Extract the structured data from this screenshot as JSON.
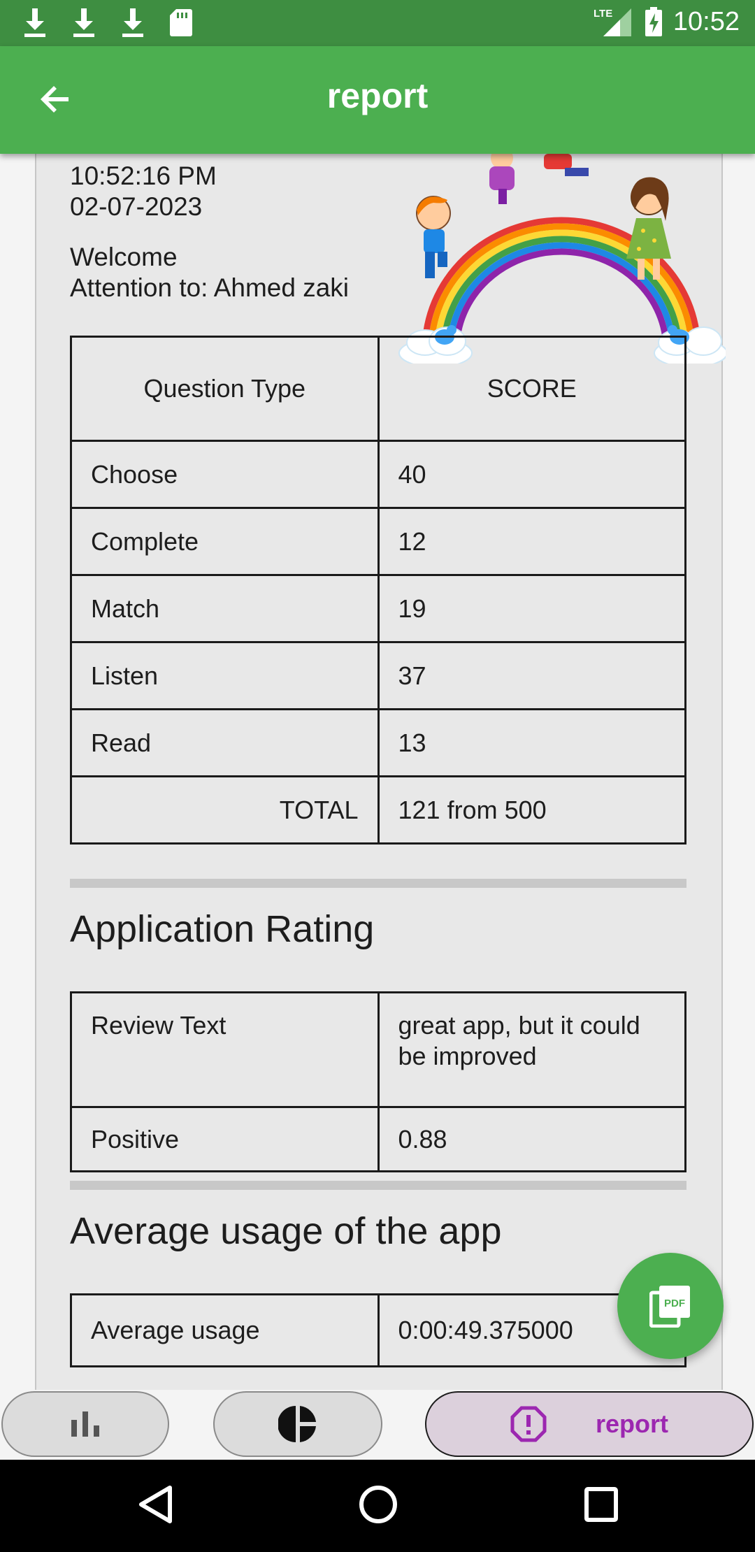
{
  "status_bar": {
    "time": "10:52",
    "network": "LTE",
    "icons": [
      "download-icon",
      "download-icon",
      "download-icon",
      "sd-card-icon",
      "signal-icon",
      "battery-charging-icon"
    ]
  },
  "app_bar": {
    "title": "report",
    "back_icon": "arrow-back-icon"
  },
  "header": {
    "time": "10:52:16 PM",
    "date": "02-07-2023",
    "welcome": "Welcome",
    "attention": "Attention to: Ahmed zaki"
  },
  "scores": {
    "col1": "Question Type",
    "col2": "SCORE",
    "rows": [
      {
        "type": "Choose",
        "score": "40"
      },
      {
        "type": "Complete",
        "score": "12"
      },
      {
        "type": "Match",
        "score": "19"
      },
      {
        "type": "Listen",
        "score": "37"
      },
      {
        "type": "Read",
        "score": "13"
      }
    ],
    "total_label": "TOTAL",
    "total_value": "121 from 500"
  },
  "rating": {
    "title": "Application Rating",
    "review_label": "Review Text",
    "review_value": "great app, but it could be improved",
    "sentiment_label": "Positive",
    "sentiment_value": "0.88"
  },
  "usage": {
    "title": "Average usage of the app",
    "label": "Average usage",
    "value": "0:00:49.375000"
  },
  "fab": {
    "icon": "pdf-icon"
  },
  "bottom_tabs": [
    {
      "icon": "bar-chart-icon",
      "label": ""
    },
    {
      "icon": "pie-chart-icon",
      "label": ""
    },
    {
      "icon": "alert-circle-icon",
      "label": "report",
      "selected": true
    }
  ],
  "colors": {
    "primary": "#4caf50",
    "status_bar": "#3e8e41",
    "accent": "#9c27b0"
  }
}
